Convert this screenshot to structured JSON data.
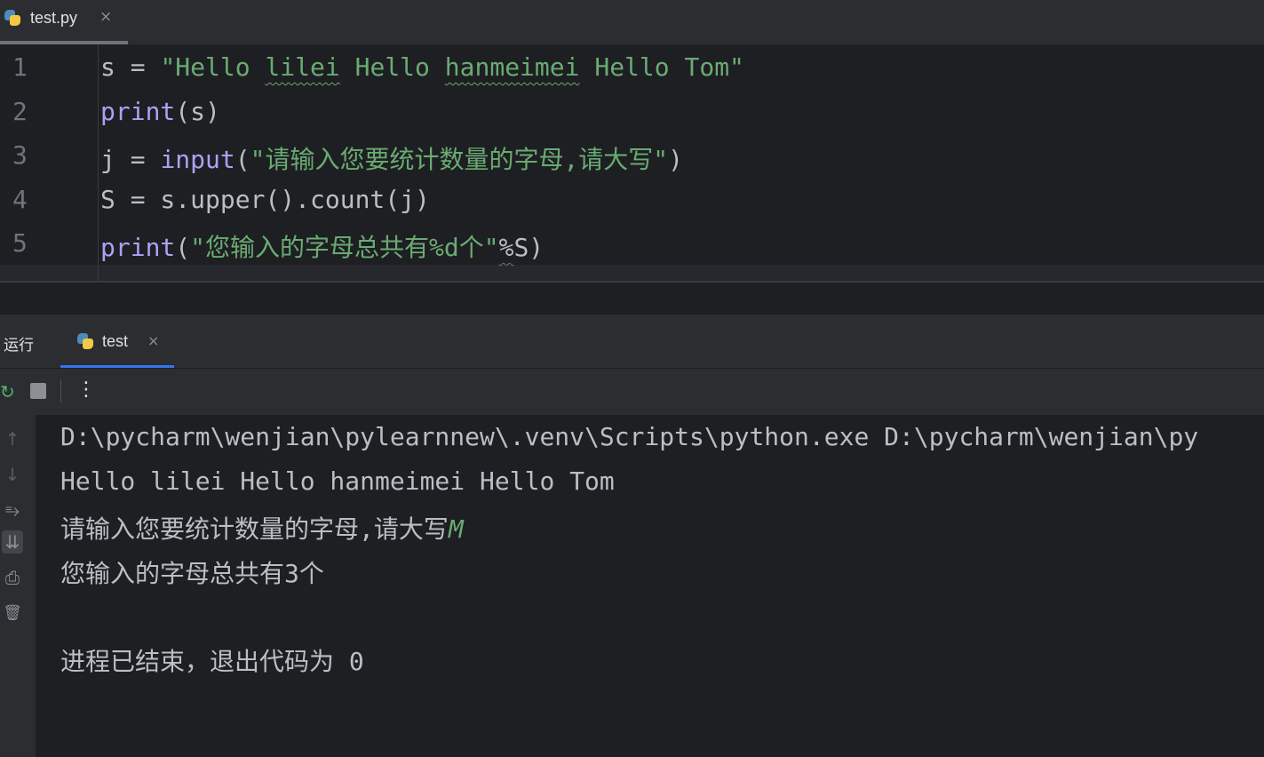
{
  "editor_tab": {
    "label": "test.py",
    "close": "×"
  },
  "editor": {
    "line_numbers": [
      "1",
      "2",
      "3",
      "4",
      "5"
    ],
    "lines": {
      "l1": {
        "a": "s = ",
        "b": "\"Hello ",
        "c": "lilei",
        "d": " Hello ",
        "e": "hanmeimei",
        "f": " Hello Tom\""
      },
      "l2": {
        "a": "print",
        "b": "(s)"
      },
      "l3": {
        "a": "j = ",
        "b": "input",
        "c": "(",
        "d": "\"请输入您要统计数量的字母,请大写\"",
        "e": ")"
      },
      "l4": {
        "a": "S = s.upper().count(j)"
      },
      "l5": {
        "a": "print",
        "b": "(",
        "c": "\"您输入的字母总共有%d个\"",
        "d": "%",
        "e": "S)"
      }
    }
  },
  "run_panel": {
    "title": "运行",
    "tab_label": "test",
    "tab_close": "×"
  },
  "toolbar": {
    "rerun_icon": "↻",
    "more_icon": "⋮"
  },
  "sidebar": {
    "up": "↑",
    "down": "↓",
    "wrap": "⥱",
    "scroll_end": "⇊",
    "print": "⎙",
    "trash": "🗑"
  },
  "console": {
    "line1": "D:\\pycharm\\wenjian\\pylearnnew\\.venv\\Scripts\\python.exe D:\\pycharm\\wenjian\\py",
    "line2": "Hello lilei Hello hanmeimei Hello Tom",
    "line3_prompt": "请输入您要统计数量的字母,请大写",
    "line3_input": "M",
    "line4": "您输入的字母总共有3个",
    "line5": "进程已结束，退出代码为 0"
  },
  "colors": {
    "background": "#1e1f22",
    "panel": "#2b2d30",
    "string": "#6aab73",
    "function": "#a7a4f4",
    "accent": "#3574f0"
  }
}
